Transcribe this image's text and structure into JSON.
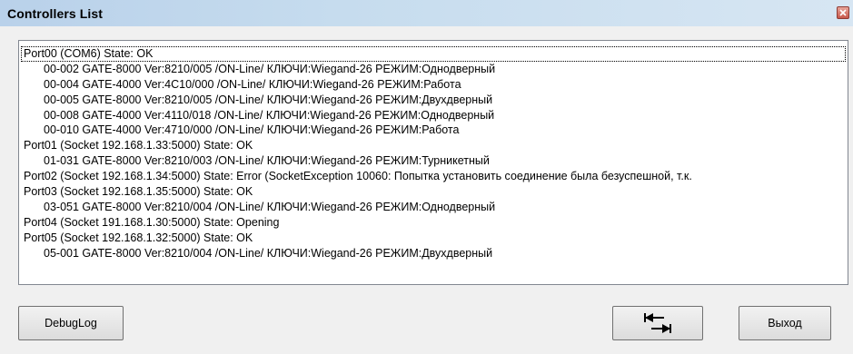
{
  "window": {
    "title": "Controllers List"
  },
  "list": {
    "lines": [
      {
        "text": "Port00 (COM6) State: OK",
        "indent": false
      },
      {
        "text": "00-002  GATE-8000  Ver:8210/005  /ON-Line/  КЛЮЧИ:Wiegand-26  РЕЖИМ:Однодверный",
        "indent": true
      },
      {
        "text": "00-004  GATE-4000  Ver:4C10/000  /ON-Line/  КЛЮЧИ:Wiegand-26  РЕЖИМ:Работа",
        "indent": true
      },
      {
        "text": "00-005  GATE-8000  Ver:8210/005  /ON-Line/  КЛЮЧИ:Wiegand-26  РЕЖИМ:Двухдверный",
        "indent": true
      },
      {
        "text": "00-008  GATE-4000  Ver:4110/018  /ON-Line/  КЛЮЧИ:Wiegand-26  РЕЖИМ:Однодверный",
        "indent": true
      },
      {
        "text": "00-010  GATE-4000  Ver:4710/000  /ON-Line/  КЛЮЧИ:Wiegand-26  РЕЖИМ:Работа",
        "indent": true
      },
      {
        "text": "Port01 (Socket 192.168.1.33:5000) State: OK",
        "indent": false
      },
      {
        "text": "01-031  GATE-8000  Ver:8210/003  /ON-Line/  КЛЮЧИ:Wiegand-26  РЕЖИМ:Турникетный",
        "indent": true
      },
      {
        "text": "Port02 (Socket 192.168.1.34:5000) State: Error (SocketException 10060: Попытка установить соединение была безуспешной, т.к.",
        "indent": false
      },
      {
        "text": "Port03 (Socket 192.168.1.35:5000) State: OK",
        "indent": false
      },
      {
        "text": "03-051  GATE-8000  Ver:8210/004  /ON-Line/  КЛЮЧИ:Wiegand-26  РЕЖИМ:Однодверный",
        "indent": true
      },
      {
        "text": "Port04 (Socket 191.168.1.30:5000) State: Opening",
        "indent": false
      },
      {
        "text": "Port05 (Socket 192.168.1.32:5000) State: OK",
        "indent": false
      },
      {
        "text": "05-001  GATE-8000  Ver:8210/004  /ON-Line/  КЛЮЧИ:Wiegand-26  РЕЖИМ:Двухдверный",
        "indent": true
      }
    ]
  },
  "buttons": {
    "debug_label": "DebugLog",
    "switch_icon": "swap-arrows-icon",
    "exit_label": "Выход"
  },
  "colors": {
    "title_bar": "#c6dcee",
    "window_bg": "#f0f0f0",
    "list_bg": "#ffffff",
    "close_button": "#c7574a"
  }
}
